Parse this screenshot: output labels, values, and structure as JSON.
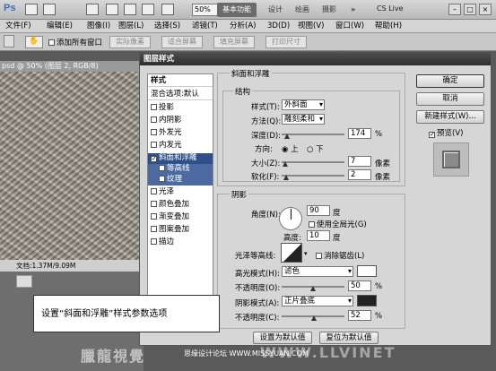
{
  "app": {
    "logo": "Ps",
    "zoom": "50%",
    "workspaces": [
      "基本功能",
      "设计",
      "绘画",
      "摄影"
    ],
    "overflow": "»",
    "cslive": "CS Live",
    "winbtns": [
      "–",
      "□",
      "×"
    ]
  },
  "menubar": [
    "文件(F)",
    "编辑(E)",
    "图像(I)",
    "图层(L)",
    "选择(S)",
    "滤镜(T)",
    "分析(A)",
    "3D(D)",
    "视图(V)",
    "窗口(W)",
    "帮助(H)"
  ],
  "options": {
    "sample_all": "添加所有窗口",
    "buttons": [
      "实际像素",
      "适合屏幕",
      "填充屏幕",
      "打印尺寸"
    ]
  },
  "doc": {
    "tab": "psd @ 50% (图层 2, RGB/8)",
    "status": "文档:1.37M/9.09M"
  },
  "dialog": {
    "title": "图层样式",
    "styles_header": "样式",
    "blend_options": "混合选项:默认",
    "effects": [
      {
        "label": "投影",
        "checked": false
      },
      {
        "label": "内阴影",
        "checked": false
      },
      {
        "label": "外发光",
        "checked": false
      },
      {
        "label": "内发光",
        "checked": false
      },
      {
        "label": "斜面和浮雕",
        "checked": true
      },
      {
        "label": "等高线",
        "checked": false
      },
      {
        "label": "纹理",
        "checked": false
      },
      {
        "label": "光泽",
        "checked": false
      },
      {
        "label": "颜色叠加",
        "checked": false
      },
      {
        "label": "渐变叠加",
        "checked": false
      },
      {
        "label": "图案叠加",
        "checked": false
      },
      {
        "label": "描边",
        "checked": false
      }
    ],
    "bevel": {
      "group": "斜面和浮雕",
      "structure": "结构",
      "style_label": "样式(T):",
      "style_value": "外斜面",
      "technique_label": "方法(Q):",
      "technique_value": "雕刻柔和",
      "depth_label": "深度(D):",
      "depth_value": "174",
      "depth_unit": "%",
      "direction_label": "方向:",
      "dir_up": "上",
      "dir_down": "下",
      "size_label": "大小(Z):",
      "size_value": "7",
      "size_unit": "像素",
      "soften_label": "软化(F):",
      "soften_value": "2",
      "soften_unit": "像素"
    },
    "shading": {
      "group": "阴影",
      "angle_label": "角度(N):",
      "angle_value": "90",
      "angle_unit": "度",
      "global_light": "使用全局光(G)",
      "altitude_label": "高度:",
      "altitude_value": "10",
      "altitude_unit": "度",
      "gloss_label": "光泽等高线:",
      "antialias": "消除锯齿(L)",
      "highlight_label": "高光模式(H):",
      "highlight_mode": "滤色",
      "highlight_color": "#ffffff",
      "hl_opacity_label": "不透明度(O):",
      "hl_opacity": "50",
      "hl_unit": "%",
      "shadow_label": "阴影模式(A):",
      "shadow_mode": "正片叠底",
      "shadow_color": "#222222",
      "sh_opacity_label": "不透明度(C):",
      "sh_opacity": "52",
      "sh_unit": "%"
    },
    "make_default": "设置为默认值",
    "reset_default": "复位为默认值",
    "ok": "确定",
    "cancel": "取消",
    "new_style": "新建样式(W)...",
    "preview": "预览(V)"
  },
  "annotation": "设置“斜面和浮雕”样式参数选项",
  "watermark": "臘龍視覺",
  "watermark2": "WWW.LLVINET",
  "credit": "思缘设计论坛 WWW.MISSYUAN.COM"
}
